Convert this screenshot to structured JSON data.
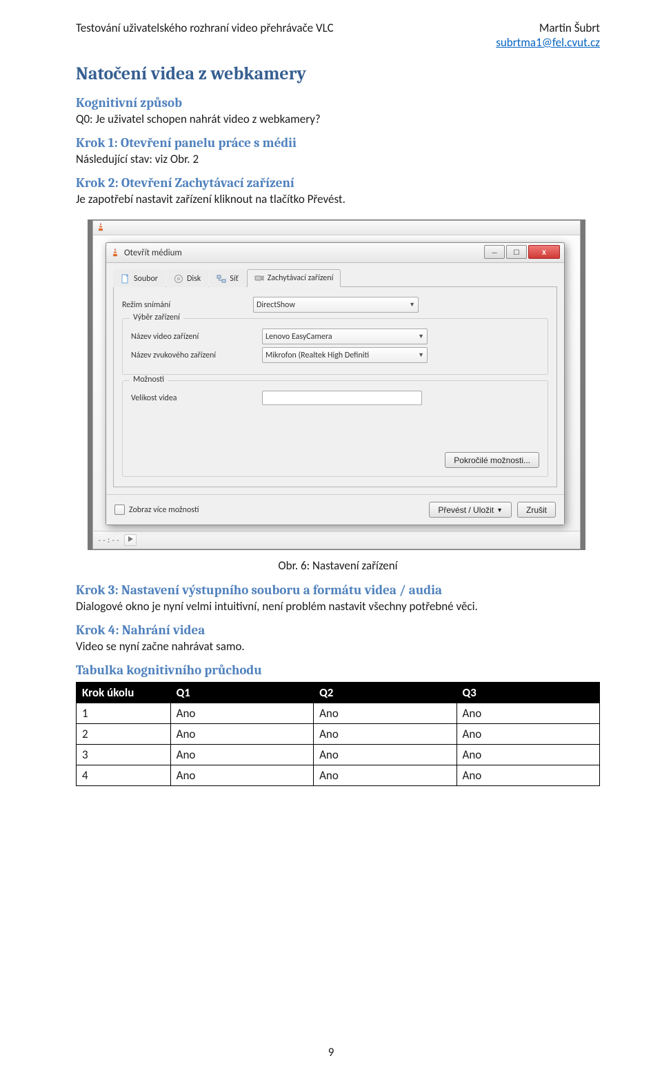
{
  "header": {
    "left": "Testování uživatelského rozhraní video přehrávače VLC",
    "right_name": "Martin Šubrt",
    "right_email": "subrtma1@fel.cvut.cz"
  },
  "title": "Natočení videa z webkamery",
  "s_kog": "Kognitivní způsob",
  "p_q0": "Q0: Je uživatel schopen nahrát video z webkamery?",
  "s_k1": "Krok 1: Otevření panelu práce s médii",
  "p_k1": "Následující stav: viz Obr. 2",
  "s_k2": "Krok 2: Otevření Zachytávací zařízení",
  "p_k2": "Je zapotřebí nastavit zařízení kliknout na tlačítko Převést.",
  "caption": "Obr. 6: Nastavení zařízení",
  "s_k3": "Krok 3: Nastavení výstupního souboru a formátu videa / audia",
  "p_k3": "Dialogové okno je nyní velmi intuitivní, není problém nastavit všechny potřebné věci.",
  "s_k4": "Krok 4: Nahrání videa",
  "p_k4": "Video se nyní začne nahrávat samo.",
  "s_tab": "Tabulka kognitivního průchodu",
  "table": {
    "headers": [
      "Krok úkolu",
      "Q1",
      "Q2",
      "Q3"
    ],
    "rows": [
      [
        "1",
        "Ano",
        "Ano",
        "Ano"
      ],
      [
        "2",
        "Ano",
        "Ano",
        "Ano"
      ],
      [
        "3",
        "Ano",
        "Ano",
        "Ano"
      ],
      [
        "4",
        "Ano",
        "Ano",
        "Ano"
      ]
    ]
  },
  "page_number": "9",
  "dialog": {
    "title": "Otevřít médium",
    "min": "—",
    "max": "☐",
    "close": "X",
    "tabs": {
      "file": "Soubor",
      "disk": "Disk",
      "net": "Síť",
      "cap": "Zachytávací zařízení"
    },
    "mode_label": "Režim snímání",
    "mode_value": "DirectShow",
    "grp_sel": "Výběr zařízení",
    "vid_label": "Název video zařízení",
    "vid_value": "Lenovo EasyCamera",
    "aud_label": "Název zvukového zařízení",
    "aud_value": "Mikrofon (Realtek High Definiti",
    "grp_opt": "Možnosti",
    "size_label": "Velikost videa",
    "adv_btn": "Pokročilé možnosti...",
    "show_more": "Zobraz více možností",
    "convert_btn": "Převést / Uložit",
    "cancel_btn": "Zrušit",
    "dashes": "--:--"
  }
}
